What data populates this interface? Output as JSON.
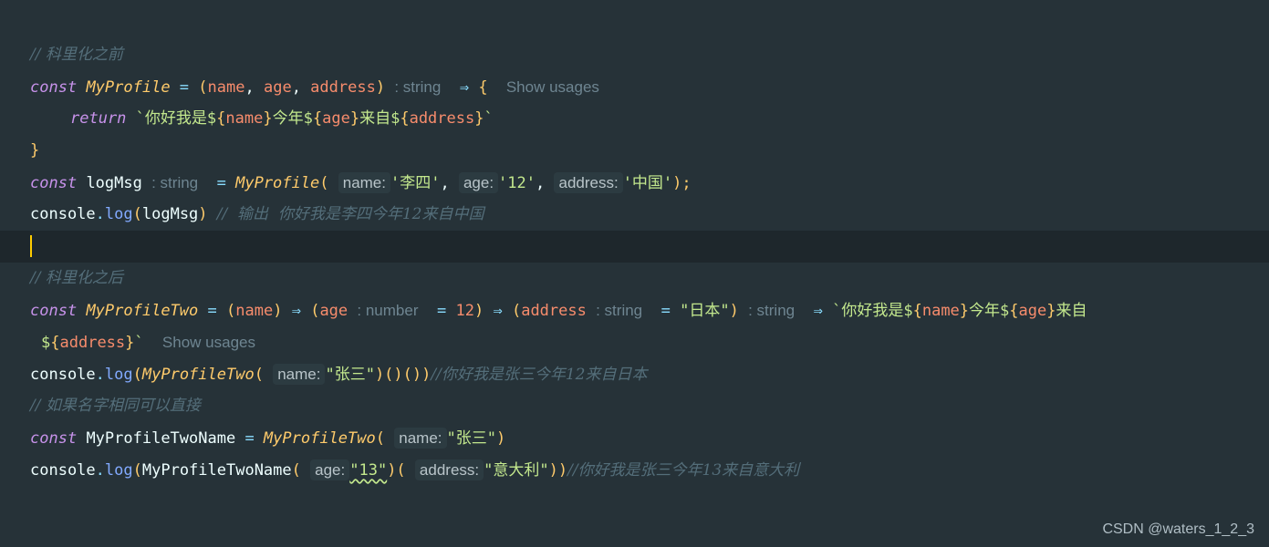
{
  "code": {
    "l1": {
      "comment": "// 科里化之前"
    },
    "l2": {
      "kw": "const",
      "fn": "MyProfile",
      "eq": " = ",
      "open": "(",
      "p1": "name",
      "comma1": ", ",
      "p2": "age",
      "comma2": ", ",
      "p3": "address",
      "close": ")",
      "type_hint": ": string",
      "arrow": "⇒",
      "brace": "{",
      "usages": "Show usages"
    },
    "l3": {
      "kw": "return",
      "tpl_start": "`你好我是$",
      "open1": "{",
      "v1": "name",
      "close1": "}",
      "mid1": "今年$",
      "open2": "{",
      "v2": "age",
      "close2": "}",
      "mid2": "来自$",
      "open3": "{",
      "v3": "address",
      "close3": "}",
      "tpl_end": "`"
    },
    "l4": {
      "brace": "}"
    },
    "l5": {
      "kw": "const",
      "name": "logMsg",
      "type_hint": ": string",
      "eq": " = ",
      "fn": "MyProfile",
      "open": "(",
      "h1": "name:",
      "a1": "'李四'",
      "c1": ", ",
      "h2": "age:",
      "a2": "'12'",
      "c2": ", ",
      "h3": "address:",
      "a3": "'中国'",
      "close": ");"
    },
    "l6": {
      "obj": "console",
      "dot": ".",
      "method": "log",
      "open": "(",
      "arg": "logMsg",
      "close": ")",
      "comment": "//  输出  你好我是李四今年12来自中国"
    },
    "l8": {
      "comment": "// 科里化之后"
    },
    "l9": {
      "kw": "const",
      "fn": "MyProfileTwo",
      "eq": " = ",
      "o1": "(",
      "p1": "name",
      "c1": ")",
      "arrow1": "⇒",
      "o2": "(",
      "p2": "age",
      "t2": ": number",
      "eq2": " = ",
      "d2": "12",
      "c2": ")",
      "arrow2": "⇒",
      "o3": "(",
      "p3": "address",
      "t3": ": string",
      "eq3": " = ",
      "d3": "\"日本\"",
      "c3": ")",
      "t4": ": string",
      "arrow3": "⇒",
      "tpl_start": "`你好我是$",
      "b1o": "{",
      "v1": "name",
      "b1c": "}",
      "mid1": "今年$",
      "b2o": "{",
      "v2": "age",
      "b2c": "}",
      "mid2": "来自"
    },
    "l10": {
      "pre": "$",
      "b3o": "{",
      "v3": "address",
      "b3c": "}",
      "tpl_end": "`",
      "usages": "Show usages"
    },
    "l11": {
      "obj": "console",
      "dot": ".",
      "method": "log",
      "open": "(",
      "fn": "MyProfileTwo",
      "fopen": "(",
      "h1": "name:",
      "a1": "\"张三\"",
      "rest": ")()())",
      "comment": "//你好我是张三今年12来自日本"
    },
    "l12": {
      "comment": "// 如果名字相同可以直接"
    },
    "l13": {
      "kw": "const",
      "name": "MyProfileTwoName",
      "eq": " = ",
      "fn": "MyProfileTwo",
      "open": "(",
      "h1": "name:",
      "a1": "\"张三\"",
      "close": ")"
    },
    "l14": {
      "obj": "console",
      "dot": ".",
      "method": "log",
      "open": "(",
      "fn": "MyProfileTwoName",
      "fopen": "(",
      "h1": "age:",
      "a1": "\"13\"",
      "mid": ")(",
      "h2": "address:",
      "a2": "\"意大利\"",
      "close": "))",
      "comment": "//你好我是张三今年13来自意大利"
    }
  },
  "watermark": "CSDN @waters_1_2_3",
  "colors": {
    "background": "#263238",
    "current_line": "#1e272c",
    "keyword": "#c792ea",
    "function": "#ffcb6b",
    "parameter": "#f78c6c",
    "string": "#c3e88d",
    "comment": "#546e7a",
    "caret": "#ffcc00"
  }
}
